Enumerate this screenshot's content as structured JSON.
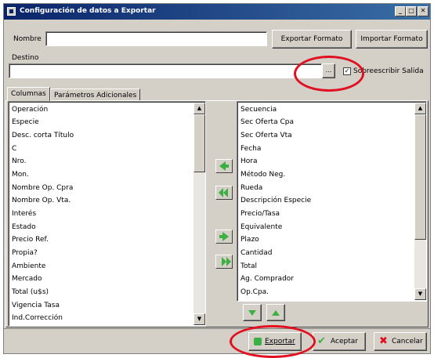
{
  "window": {
    "title": "Configuración de datos a Exportar"
  },
  "nombre": {
    "label": "Nombre",
    "value": ""
  },
  "buttons": {
    "exportar_formato": "Exportar Formato",
    "importar_formato": "Importar Formato",
    "exportar": "Exportar",
    "aceptar": "Aceptar",
    "cancelar": "Cancelar"
  },
  "destino": {
    "label": "Destino",
    "value": "",
    "browse": "..."
  },
  "sobreescribir": {
    "label": "Sobreescribir Salida",
    "checked": true
  },
  "tabs": [
    "Columnas",
    "Parámetros Adicionales"
  ],
  "left_list": [
    "Operación",
    "Especie",
    "Desc. corta Título",
    "C",
    "Nro.",
    "Mon.",
    "Nombre Op. Cpra",
    "Nombre Op. Vta.",
    "Interés",
    "Estado",
    "Precio Ref.",
    "Propia?",
    "Ambiente",
    "Mercado",
    "Total (u$s)",
    "Vigencia Tasa",
    "Ind.Corrección"
  ],
  "right_list": [
    "Secuencia",
    "Sec Oferta Cpa",
    "Sec Oferta Vta",
    "Fecha",
    "Hora",
    "Método Neg.",
    "Rueda",
    "Descripción Especie",
    "Precio/Tasa",
    "Equivalente",
    "Plazo",
    "Cantidad",
    "Total",
    "Ag. Comprador",
    "Op.Cpa."
  ],
  "colors": {
    "title_start": "#0a246a",
    "title_end": "#3a6ea5",
    "face": "#d4d0c8",
    "highlight_oval": "#e01020",
    "arrow_green": "#3cb043"
  }
}
